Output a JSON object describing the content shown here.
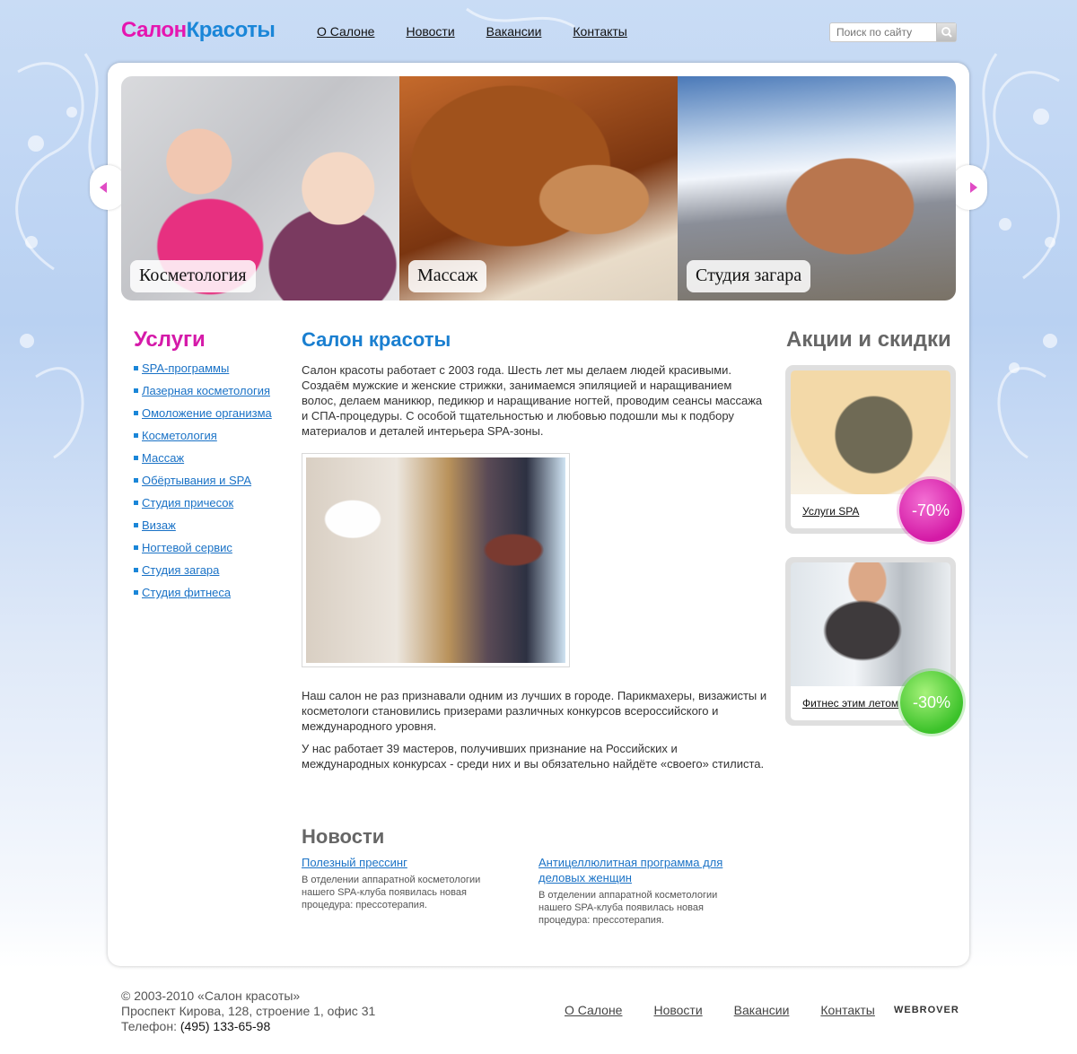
{
  "header": {
    "logo_part1": "Салон",
    "logo_part2": "Красоты",
    "nav": [
      "О Салоне",
      "Новости",
      "Вакансии",
      "Контакты"
    ],
    "search_placeholder": "Поиск по сайту"
  },
  "slider": {
    "slides": [
      "Косметология",
      "Массаж",
      "Студия загара"
    ]
  },
  "sidebar": {
    "title": "Услуги",
    "items": [
      "SPA-программы",
      "Лазерная косметология",
      "Омоложение организма",
      "Косметология",
      "Массаж",
      "Обёртывания и SPA",
      "Студия причесок",
      "Визаж",
      "Ногтевой сервис",
      "Студия загара",
      "Студия фитнеса"
    ]
  },
  "main": {
    "title": "Салон красоты",
    "para1": "Салон красоты работает с 2003 года. Шесть лет мы делаем людей красивыми. Создаём мужские и женские стрижки, занимаемся эпиляцией и наращиванием волос, делаем маникюр, педикюр и наращивание ногтей, проводим сеансы массажа и СПА-процедуры. С особой тщательностью и любовью подошли мы к подбору материалов и деталей интерьера SPA-зоны.",
    "para2": "Наш салон не раз признавали одним из лучших в городе. Парикмахеры, визажисты и косметологи становились призерами различных конкурсов всероссийского и международного уровня.",
    "para3": "У нас работает 39 мастеров, получивших признание на Российских и международных конкурсах - среди них и вы обязательно найдёте «своего» стилиста."
  },
  "news": {
    "title": "Новости",
    "items": [
      {
        "title": "Полезный прессинг",
        "text": "В отделении аппаратной косметологии нашего SPA-клуба появилась новая процедура:  прессотерапия."
      },
      {
        "title": "Антицеллюлитная программа для деловых женщин",
        "text": "В отделении аппаратной косметологии нашего SPA-клуба появилась новая процедура:  прессотерапия."
      }
    ]
  },
  "promos": {
    "title": "Акции и скидки",
    "items": [
      {
        "label": "Услуги SPA",
        "discount": "-70%"
      },
      {
        "label": "Фитнес этим летом",
        "discount": "-30%"
      }
    ]
  },
  "footer": {
    "copyright": "© 2003-2010 «Салон красоты»",
    "address": "Проспект Кирова, 128, строение 1, офис 31",
    "phone_label": "Телефон:",
    "phone": "(495) 133-65-98",
    "nav": [
      "О Салоне",
      "Новости",
      "Вакансии",
      "Контакты"
    ],
    "credit": "WEBROVER"
  },
  "colors": {
    "accent_pink": "#e516b0",
    "accent_blue": "#1a86d8",
    "badge_pink": "#d41aa6",
    "badge_green": "#3cc22a"
  }
}
